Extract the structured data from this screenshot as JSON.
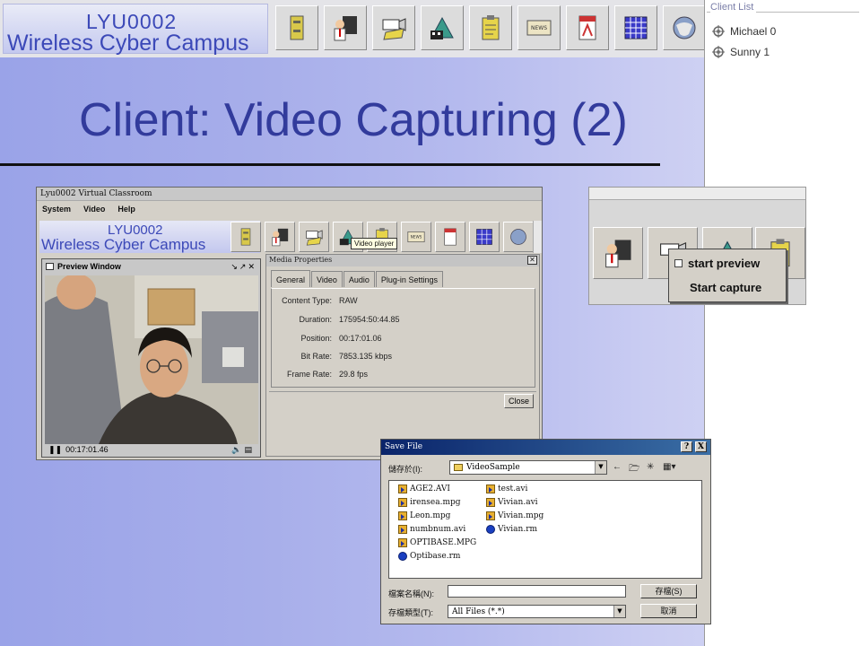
{
  "banner": {
    "logo_line1": "LYU0002",
    "logo_line2": "Wireless Cyber Campus",
    "toolbar_icons": [
      "cabinet-icon",
      "teacher-icon",
      "video-camera-icon",
      "film-mountain-icon",
      "clipboard-icon",
      "news-icon",
      "pdf-icon",
      "calendar-icon",
      "cyber-globe-icon"
    ]
  },
  "client_list": {
    "title": "Client List",
    "clients": [
      "Michael 0",
      "Sunny 1"
    ]
  },
  "slide": {
    "title": "Client: Video Capturing (2)"
  },
  "classroom_window": {
    "title": "Lyu0002 Virtual Classroom",
    "menu": [
      "System",
      "Video",
      "Help"
    ],
    "logo_line1": "LYU0002",
    "logo_line2": "Wireless Cyber Campus",
    "tooltip": "Video player"
  },
  "preview_window": {
    "title": "Preview Window",
    "time": "00:17:01.46",
    "controls": "↘↗✕"
  },
  "media_properties": {
    "title": "Media Properties",
    "tabs": [
      "General",
      "Video",
      "Audio",
      "Plug-in Settings"
    ],
    "properties": [
      {
        "key": "Content Type:",
        "value": "RAW"
      },
      {
        "key": "Duration:",
        "value": "175954:50:44.85"
      },
      {
        "key": "Position:",
        "value": "00:17:01.06"
      },
      {
        "key": "Bit Rate:",
        "value": "7853.135 kbps"
      },
      {
        "key": "Frame Rate:",
        "value": "29.8 fps"
      }
    ],
    "close_label": "Close"
  },
  "capture_popup": {
    "items": [
      "start preview",
      "Start capture"
    ]
  },
  "save_dialog": {
    "title": "Save File",
    "help_btn": "?",
    "close_btn": "X",
    "save_in_label": "儲存於(I):",
    "folder": "VideoSample",
    "files_col1": [
      "AGE2.AVI",
      "irensea.mpg",
      "Leon.mpg",
      "numbnum.avi",
      "OPTIBASE.MPG",
      "Optibase.rm"
    ],
    "files_col2": [
      "test.avi",
      "Vivian.avi",
      "Vivian.mpg",
      "Vivian.rm"
    ],
    "filename_label": "檔案名稱(N):",
    "filename_value": "",
    "filetype_label": "存檔類型(T):",
    "filetype_value": "All Files (*.*)",
    "save_button": "存檔(S)",
    "cancel_button": "取消"
  }
}
